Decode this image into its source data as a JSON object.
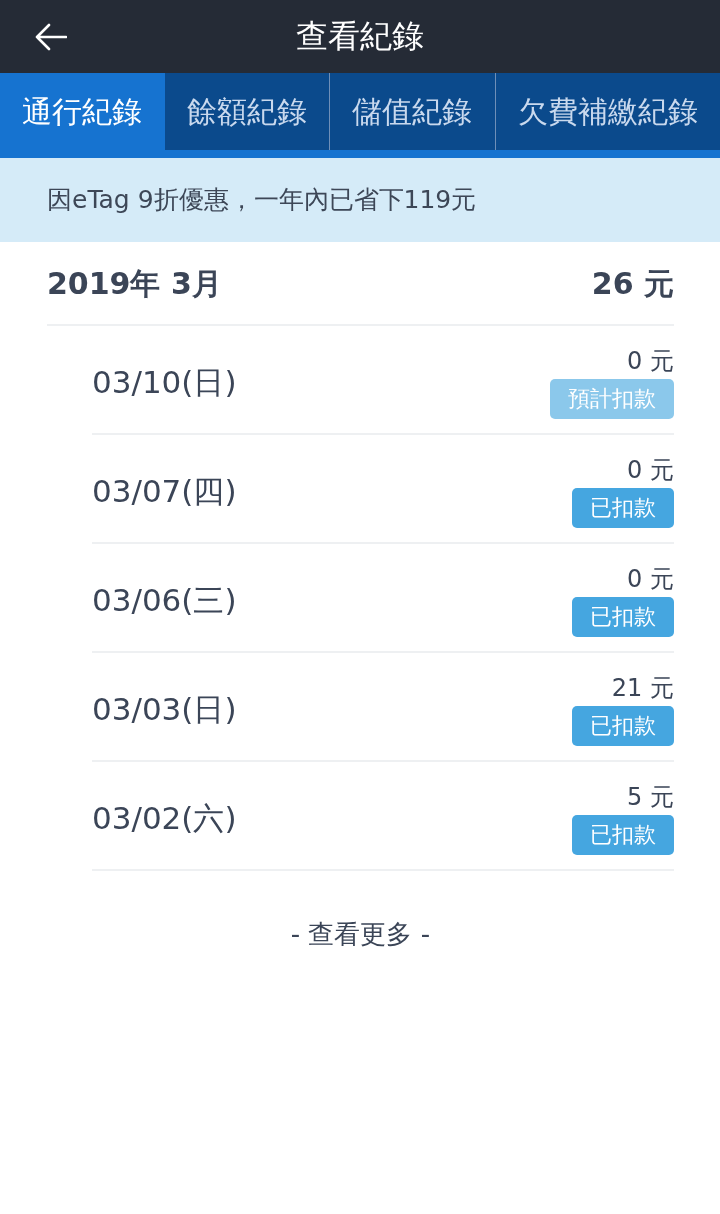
{
  "header": {
    "title": "查看紀錄"
  },
  "tabs": [
    {
      "label": "通行紀錄",
      "selected": true
    },
    {
      "label": "餘額紀錄",
      "selected": false
    },
    {
      "label": "儲值紀錄",
      "selected": false
    },
    {
      "label": "欠費補繳紀錄",
      "selected": false
    }
  ],
  "notice": "因eTag 9折優惠，一年內已省下119元",
  "month": {
    "label": "2019年 3月",
    "total": "26 元"
  },
  "records": [
    {
      "date": "03/10(日)",
      "amount": "0 元",
      "status": {
        "label": "預計扣款",
        "kind": "pending"
      }
    },
    {
      "date": "03/07(四)",
      "amount": "0 元",
      "status": {
        "label": "已扣款",
        "kind": "charged"
      }
    },
    {
      "date": "03/06(三)",
      "amount": "0 元",
      "status": {
        "label": "已扣款",
        "kind": "charged"
      }
    },
    {
      "date": "03/03(日)",
      "amount": "21 元",
      "status": {
        "label": "已扣款",
        "kind": "charged"
      }
    },
    {
      "date": "03/02(六)",
      "amount": "5 元",
      "status": {
        "label": "已扣款",
        "kind": "charged"
      }
    }
  ],
  "more_link": "- 查看更多 -"
}
